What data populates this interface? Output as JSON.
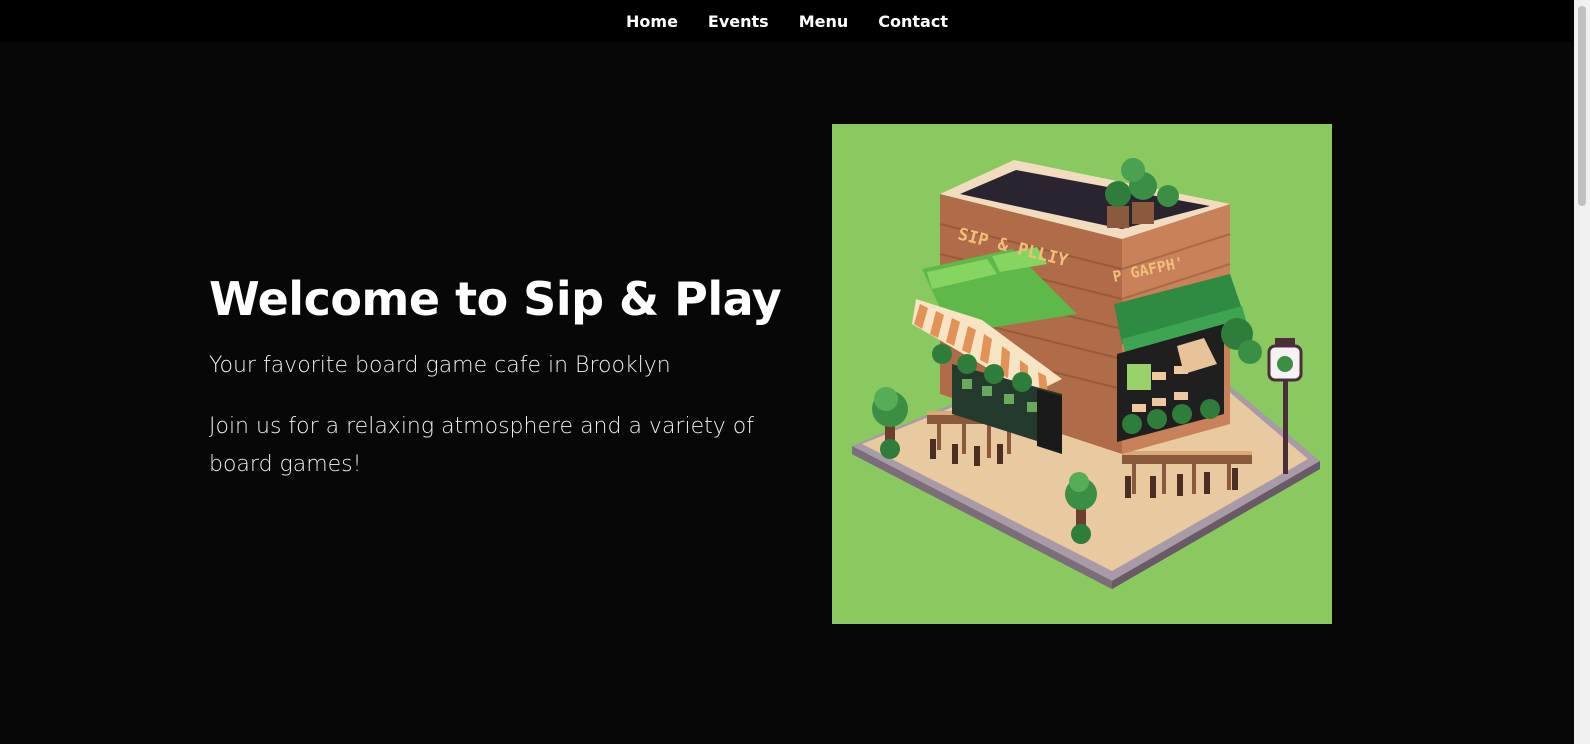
{
  "nav": {
    "items": [
      {
        "label": "Home"
      },
      {
        "label": "Events"
      },
      {
        "label": "Menu"
      },
      {
        "label": "Contact"
      }
    ]
  },
  "hero": {
    "title": "Welcome to Sip & Play",
    "subtitle": "Your favorite board game cafe in Brooklyn",
    "description": "Join us for a relaxing atmosphere and a variety of board games!"
  },
  "image": {
    "sign_left": "SIP & PLLIY",
    "sign_right": "P GAFPH'"
  },
  "colors": {
    "background": "#070707",
    "nav_background": "#000000",
    "image_background": "#8ac95f"
  }
}
